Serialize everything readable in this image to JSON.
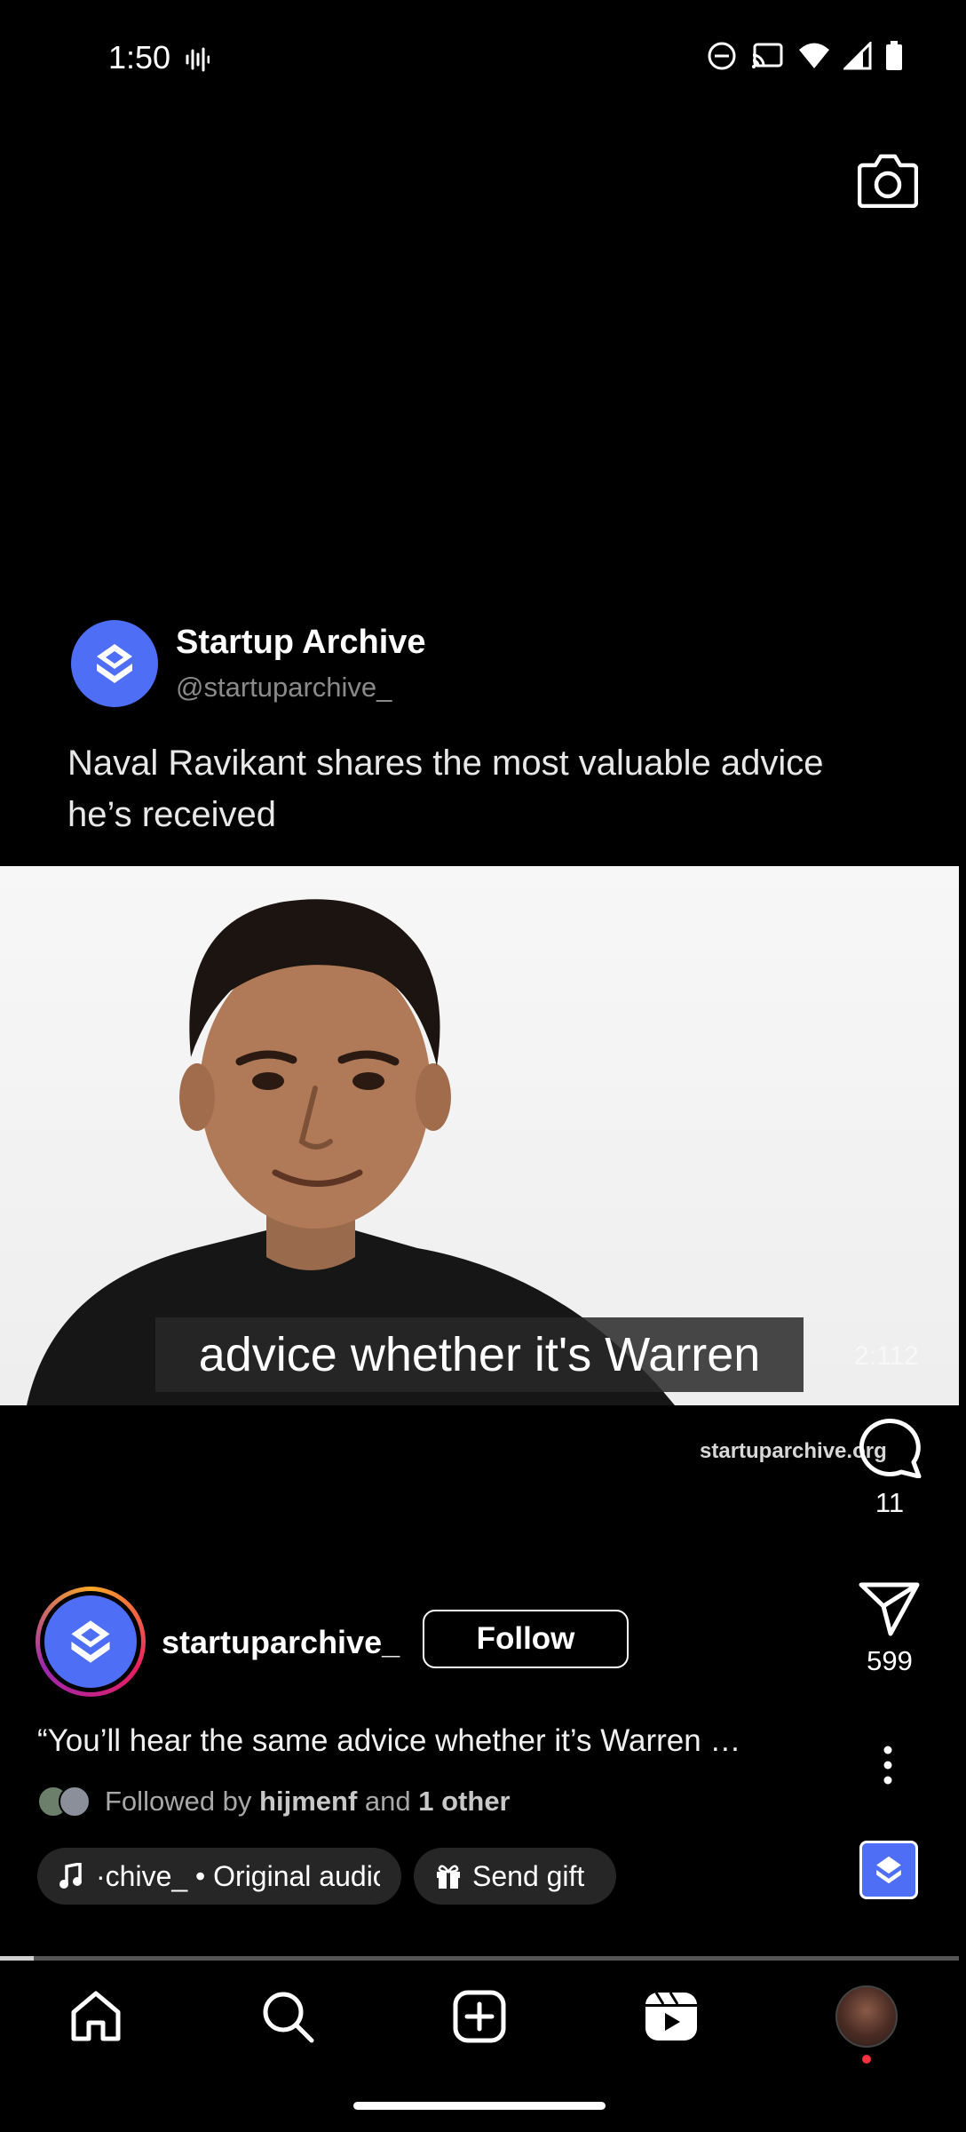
{
  "status_bar": {
    "time": "1:50"
  },
  "post": {
    "channel_name": "Startup Archive",
    "channel_handle": "@startuparchive_",
    "text": "Naval Ravikant shares the most valuable advice he’s received"
  },
  "video": {
    "caption": "advice whether it's Warren",
    "timer": "2:112",
    "watermark": "startuparchive.org",
    "progress": 0.035
  },
  "actions": {
    "comments_count": "11",
    "shares_count": "599"
  },
  "author": {
    "username": "startuparchive_",
    "follow_label": "Follow",
    "caption": "“You’ll hear the same advice whether it’s Warren …",
    "followed_prefix": "Followed by",
    "followed_user": "hijmenf",
    "followed_and": "and",
    "followed_other": "1 other"
  },
  "pills": {
    "audio": "·chive_ • Original audio",
    "gift": "Send gift"
  },
  "colors": {
    "brand": "#4d6ef5",
    "background": "#000000"
  },
  "nav": {
    "items": [
      "home-icon",
      "search-icon",
      "create-icon",
      "reels-icon",
      "profile-avatar"
    ]
  }
}
